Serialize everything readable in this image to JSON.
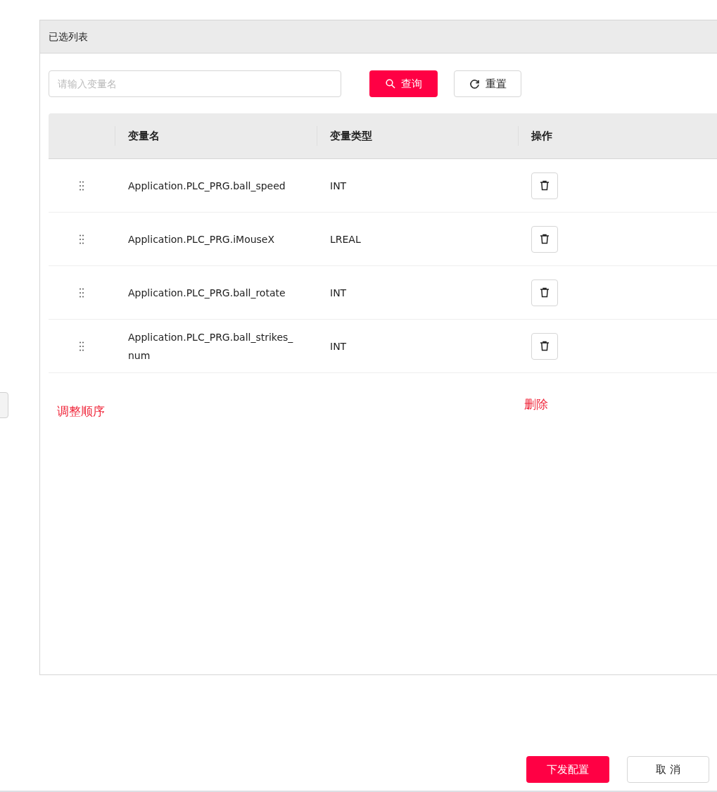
{
  "panel": {
    "title": "已选列表"
  },
  "search": {
    "placeholder": "请输入变量名"
  },
  "toolbar_buttons": [
    {
      "kind": "primary",
      "label": "查询"
    },
    {
      "kind": "secondary",
      "label": "重置"
    }
  ],
  "table": {
    "columns": [
      "变量名",
      "变量类型",
      "操作"
    ],
    "rows": [
      {
        "name": "Application.PLC_PRG.ball_speed",
        "type": "INT"
      },
      {
        "name": "Application.PLC_PRG.iMouseX",
        "type": "LREAL"
      },
      {
        "name": "Application.PLC_PRG.ball_rotate",
        "type": "INT"
      },
      {
        "name": "Application.PLC_PRG.ball_strikes_num",
        "type": "INT"
      }
    ]
  },
  "annotations": [
    "调整顺序",
    "删除"
  ],
  "footer_buttons": [
    {
      "kind": "primary",
      "label": "下发配置"
    },
    {
      "kind": "secondary",
      "label": "取 消"
    }
  ]
}
